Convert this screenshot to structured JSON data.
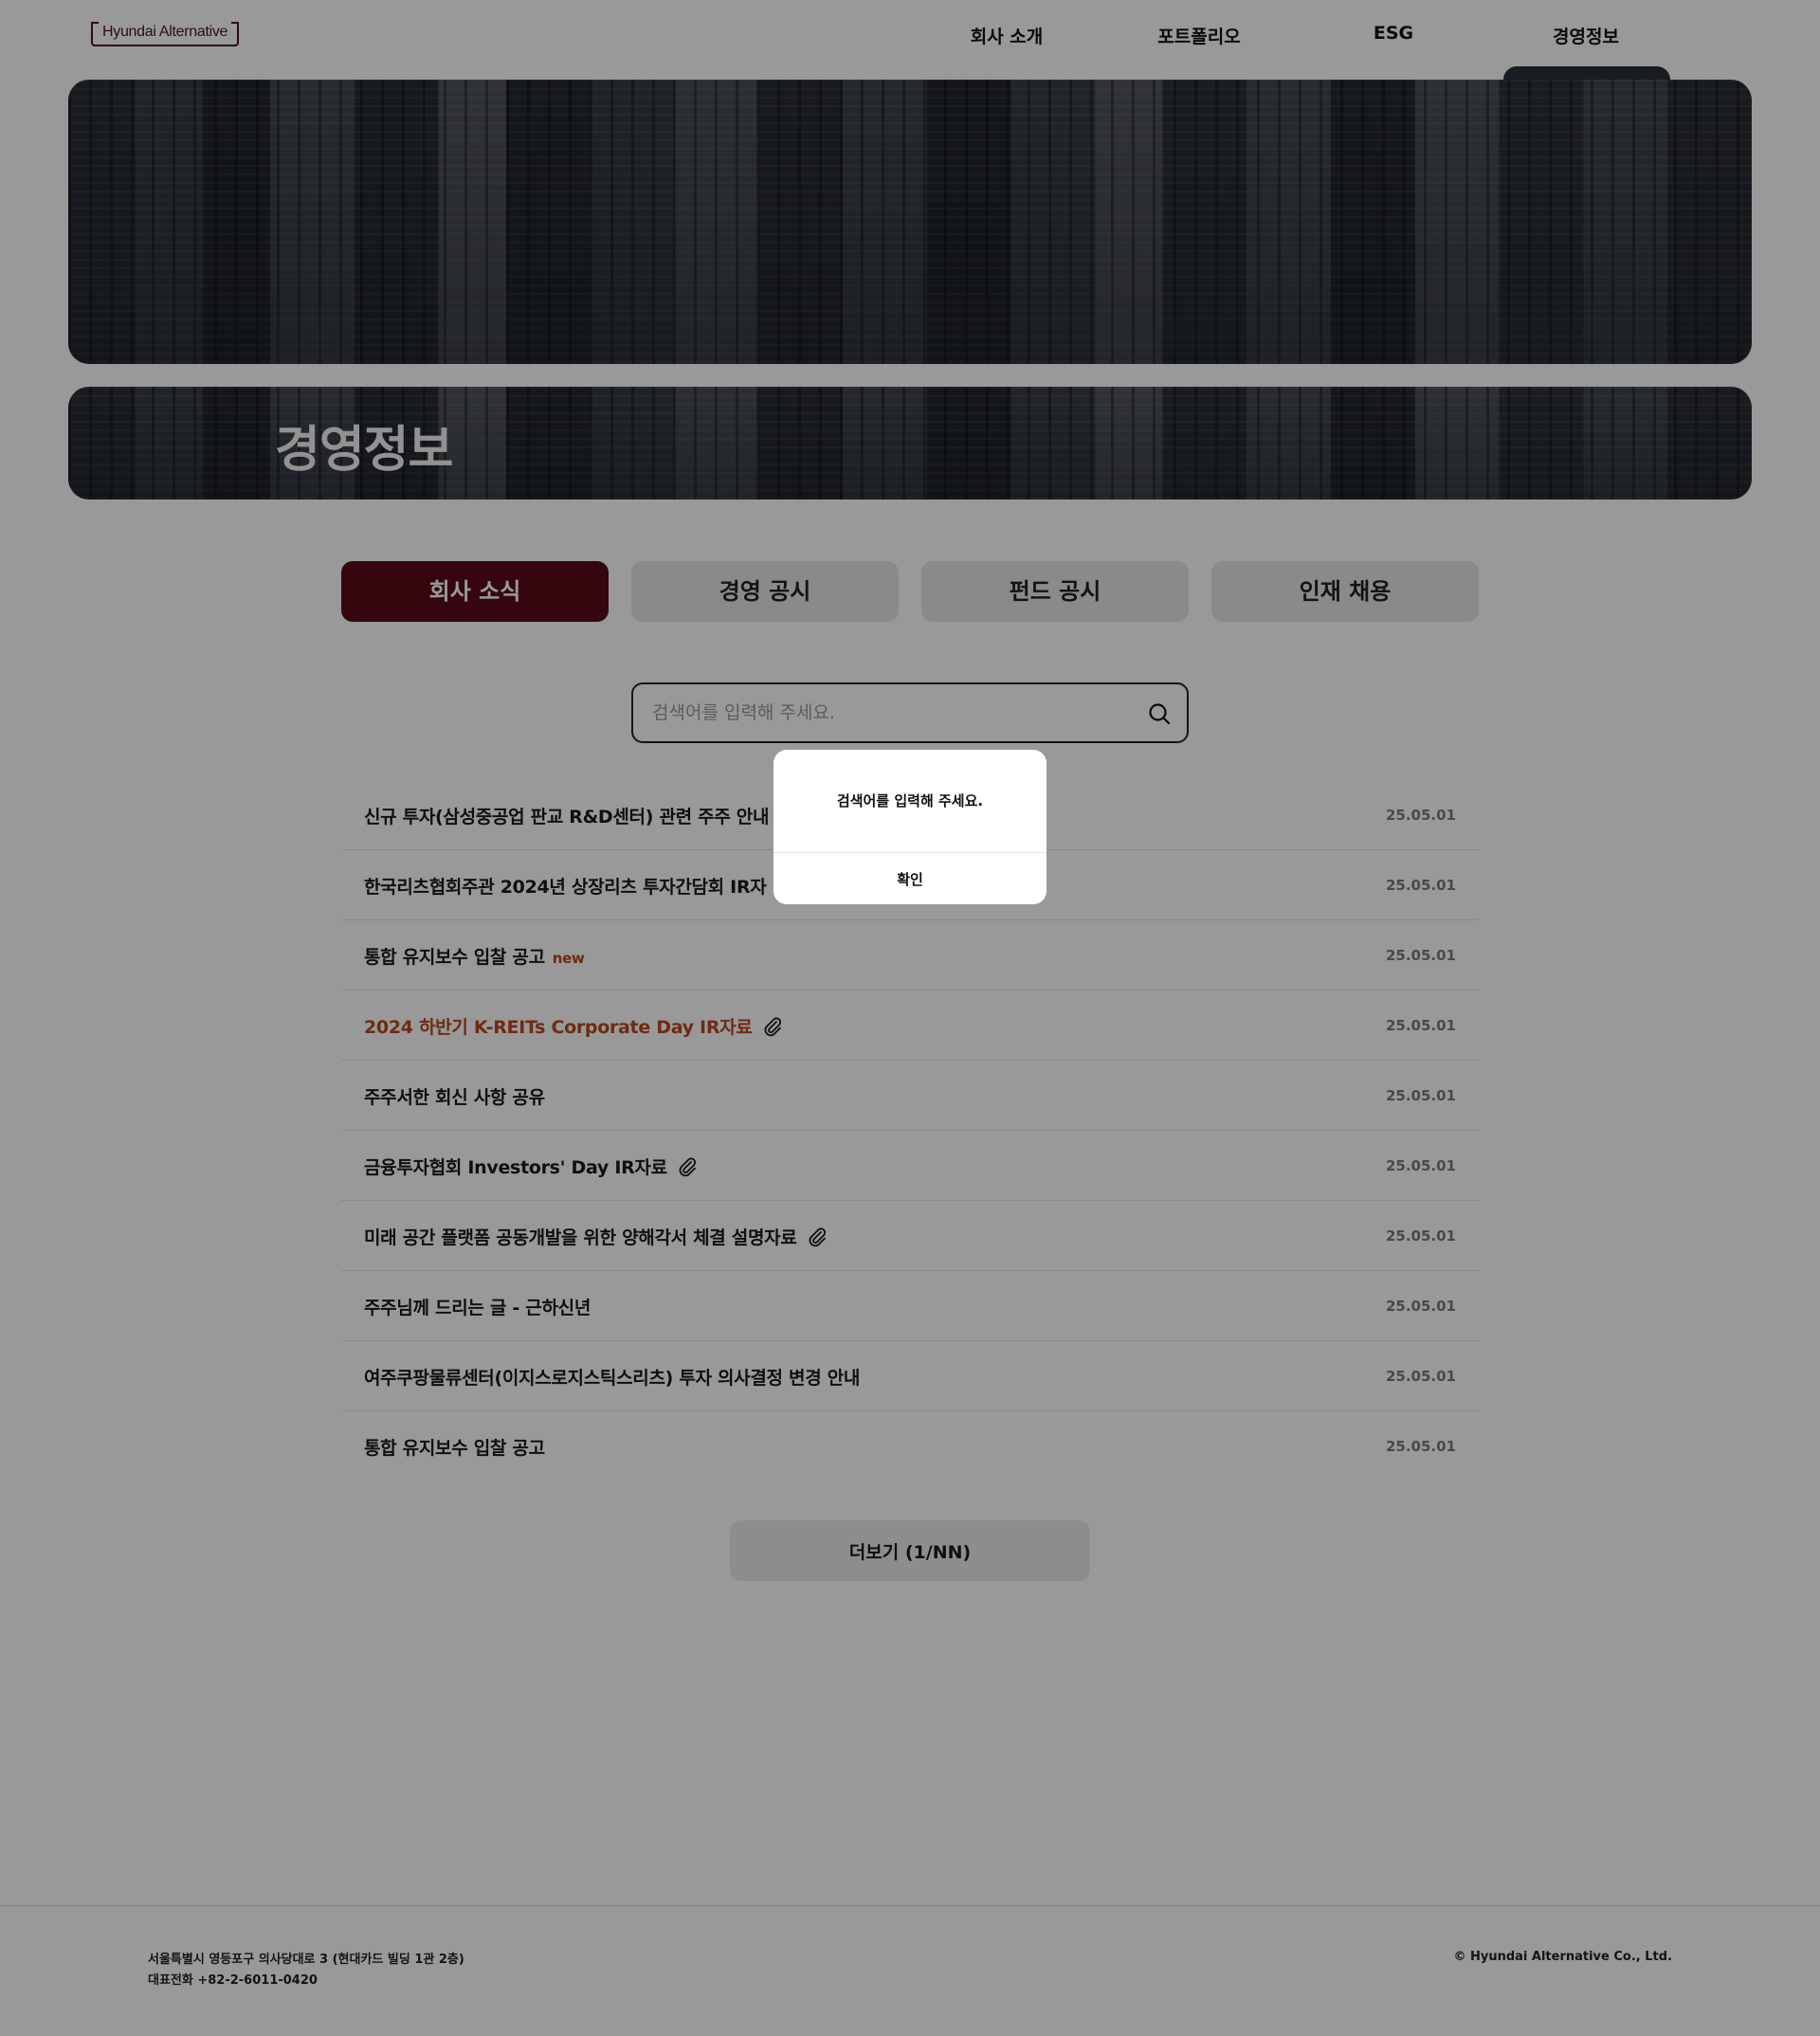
{
  "header": {
    "logo": "Hyundai Alternative",
    "nav": [
      {
        "label": "회사 소개"
      },
      {
        "label": "포트폴리오"
      },
      {
        "label": "ESG"
      },
      {
        "label": "경영정보"
      }
    ]
  },
  "hero": {
    "title": "경영정보"
  },
  "tabs": [
    {
      "label": "회사 소식",
      "active": true
    },
    {
      "label": "경영 공시",
      "active": false
    },
    {
      "label": "펀드 공시",
      "active": false
    },
    {
      "label": "인재 채용",
      "active": false
    }
  ],
  "search": {
    "placeholder": "검색어를 입력해 주세요.",
    "value": ""
  },
  "posts": [
    {
      "title": "신규 투자(삼성중공업 판교 R&D센터) 관련 주주 안내",
      "date": "25.05.01"
    },
    {
      "title": "한국리츠협회주관 2024년 상장리츠 투자간담회 IR자",
      "date": "25.05.01"
    },
    {
      "title": "통합 유지보수 입찰 공고",
      "badge": "new",
      "date": "25.05.01"
    },
    {
      "title": "2024 하반기 K-REITs Corporate Day IR자료",
      "attachment": "paperclip-icon",
      "date": "25.05.01"
    },
    {
      "title": "주주서한 회신 사항 공유",
      "date": "25.05.01"
    },
    {
      "title": "금융투자협회 Investors' Day IR자료",
      "attachment": "paperclip-icon",
      "date": "25.05.01"
    },
    {
      "title": "미래 공간 플랫폼 공동개발을 위한 양해각서 체결 설명자료",
      "attachment": "paperclip-icon",
      "date": "25.05.01"
    },
    {
      "title": "주주님께 드리는 글 - 근하신년",
      "date": "25.05.01"
    },
    {
      "title": "여주쿠팡물류센터(이지스로지스틱스리츠) 투자 의사결정 변경 안내",
      "date": "25.05.01"
    },
    {
      "title": "통합 유지보수 입찰 공고",
      "date": "25.05.01"
    }
  ],
  "more_button": "더보기 (1/NN)",
  "footer": {
    "address": "서울특별시 영등포구 의사당대로 3 (현대카드 빌딩 1관 2층)",
    "phone": "대표전화 +82-2-6011-0420",
    "copyright": "© Hyundai Alternative Co., Ltd."
  },
  "dialog": {
    "message": "검색어를 입력해 주세요.",
    "confirm": "확인"
  },
  "colors": {
    "brand": "#5a0a1a",
    "accent": "#b8481e",
    "overlay": "rgba(0,0,0,0.4)"
  }
}
